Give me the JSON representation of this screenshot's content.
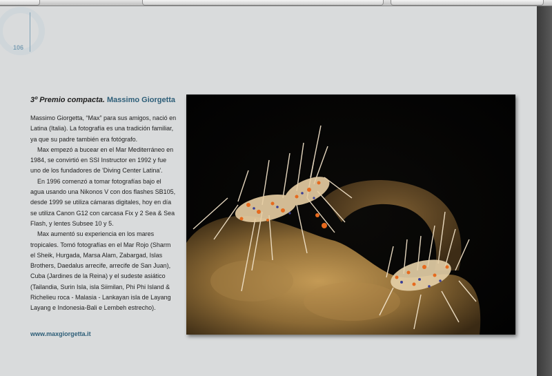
{
  "page": {
    "number": "106",
    "accent_color": "#2d5e78"
  },
  "article": {
    "prize": "3º Premio compacta.",
    "photographer": "Massimo Giorgetta",
    "paragraphs": [
      "Massimo Giorgetta, “Max” para sus amigos, nació en Latina (Italia). La fotografía es una tradición familiar, ya que su padre  también era fotógrafo.",
      "Max empezó a bucear en el Mar Mediterráneo en 1984, se convirtió en SSI Instructor en 1992 y fue uno de los fundadores de 'Diving Center Latina'.",
      "En 1996 comenzó a tomar fotografías bajo el agua usando una Nikonos V con dos flashes SB105, desde 1999 se utiliza cámaras digitales, hoy en día se utiliza Canon G12 con carcasa Fix y 2 Sea & Sea Flash, y lentes Subsee 10 y 5.",
      "Max aumentó su experiencia en los mares tropicales. Tomó fotografías en el Mar Rojo (Sharm el Sheik, Hurgada, Marsa Alam, Zabargad, Islas Brothers, Daedalus arrecife, arrecife de San Juan), Cuba (Jardines de la Reina) y el sudeste asiático (Tailandia, Surin Isla, isla Siimilan, Phi Phi Island & Richelieu roca - Malasia - Lankayan isla de Layang Layang e Indonesia-Bali e Lembeh estrecho)."
    ],
    "website": "www.maxgiorgetta.it"
  }
}
